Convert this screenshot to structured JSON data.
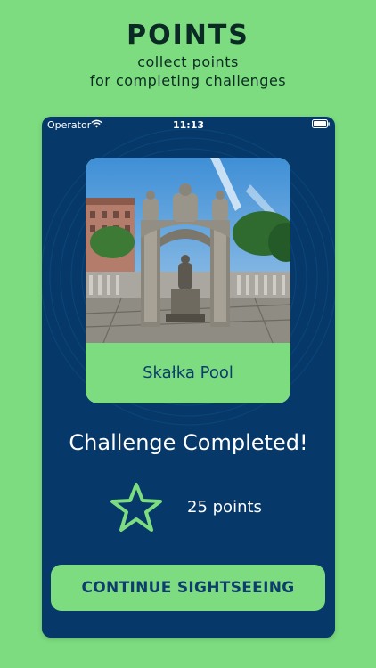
{
  "promo": {
    "title": "POINTS",
    "subtitle_line1": "collect points",
    "subtitle_line2": "for completing challenges"
  },
  "status_bar": {
    "carrier": "Operator",
    "time": "11:13",
    "icons": [
      "wifi-icon",
      "battery-icon"
    ]
  },
  "card": {
    "place_name": "Skałka Pool",
    "photo": "photo of an ornate stone pool fountain with statue and sky"
  },
  "result": {
    "message": "Challenge Completed!",
    "points": "25 points",
    "icon": "star-icon"
  },
  "actions": {
    "continue_label": "CONTINUE SIGHTSEEING"
  },
  "colors": {
    "background": "#7ddc7f",
    "screen": "#063869",
    "accent": "#7ddc7f",
    "button_text": "#0c3d6c"
  }
}
